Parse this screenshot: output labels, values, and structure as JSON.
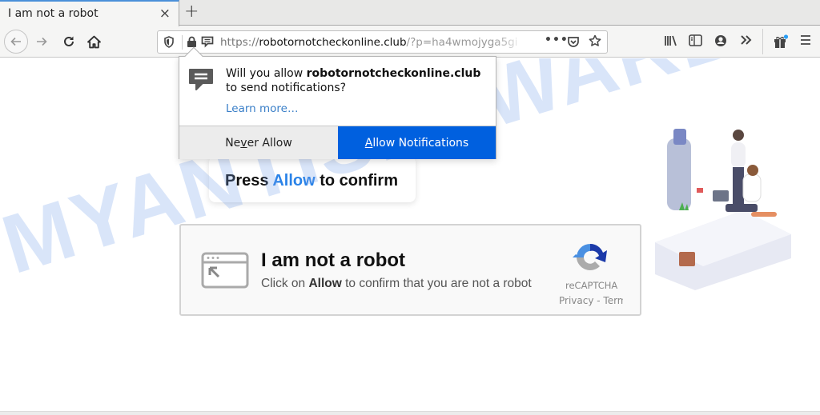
{
  "tab": {
    "title": "I am not a robot",
    "close_label": "×",
    "new_tab_label": "+"
  },
  "urlbar": {
    "scheme": "https://",
    "host": "robotornotcheckonline.club",
    "path": "/?p=ha4wmojyga5gi",
    "more_label": "•••"
  },
  "popup": {
    "message_prefix": "Will you allow ",
    "site": "robotornotcheckonline.club",
    "message_suffix": "to send notifications?",
    "learn_more": "Learn more…",
    "never_allow": "Never Allow",
    "never_allow_mnemonic_pre": "Ne",
    "never_allow_mnemonic": "v",
    "never_allow_mnemonic_post": "er Allow",
    "allow_mnemonic": "A",
    "allow_rest": "llow Notifications",
    "accent_color": "#0060df"
  },
  "page": {
    "press_prefix": "Press ",
    "press_allow": "Allow",
    "press_suffix": " to confirm",
    "captcha_title": "I am not a robot",
    "captcha_sub_prefix": "Click on ",
    "captcha_sub_bold": "Allow",
    "captcha_sub_suffix": " to confirm that you are not a robot",
    "recaptcha_label": "reCAPTCHA",
    "recaptcha_links": "Privacy - Terms",
    "watermark": "MYANTISPYWARE.COM"
  },
  "icons": {
    "back": "arrow-left-icon",
    "forward": "arrow-right-icon",
    "reload": "reload-icon",
    "home": "home-icon",
    "tracking": "shield-icon",
    "lock": "lock-icon",
    "notification": "notification-icon",
    "pocket": "pocket-icon",
    "bookmark": "star-icon",
    "library": "library-icon",
    "sidebar": "sidebar-icon",
    "account": "account-icon",
    "overflow": "chevron-double-right-icon",
    "whatsnew": "gift-icon",
    "menu": "hamburger-menu-icon"
  }
}
